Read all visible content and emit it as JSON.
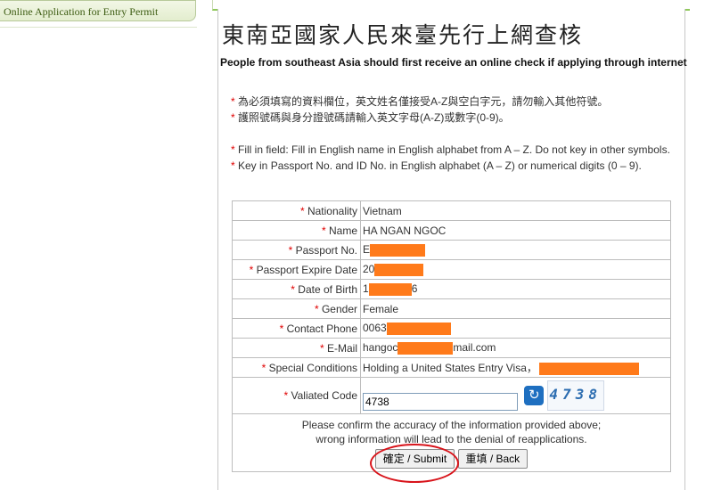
{
  "sidebar": {
    "link_label": "Online Application for Entry Permit"
  },
  "header": {
    "title_zh": "東南亞國家人民來臺先行上網查核",
    "title_en": "People from southeast Asia should first receive an online check if applying through internet"
  },
  "notes": {
    "star": "*",
    "zh_1": " 為必須填寫的資料欄位，英文姓名僅接受A-Z與空白字元，請勿輸入其他符號。",
    "zh_2": " 護照號碼與身分證號碼請輸入英文字母(A-Z)或數字(0-9)。",
    "en_1": " Fill in field: Fill in English name in English alphabet from A – Z. Do not key in other symbols.",
    "en_2": " Key in Passport No. and ID No. in English alphabet (A – Z) or numerical digits (0 – 9)."
  },
  "form": {
    "star": "*",
    "nationality_label": " Nationality",
    "nationality_value": "Vietnam",
    "name_label": " Name",
    "name_value": "HA NGAN NGOC",
    "passport_label": " Passport No.",
    "passport_prefix": "E",
    "expire_label": " Passport Expire Date",
    "expire_prefix": "20",
    "dob_label": " Date of Birth",
    "dob_prefix": "1",
    "dob_suffix": "6",
    "gender_label": " Gender",
    "gender_value": "Female",
    "phone_label": " Contact Phone",
    "phone_prefix": "0063",
    "email_label": " E-Mail",
    "email_prefix": "hangoc",
    "email_suffix": "mail.com",
    "special_label": " Special Conditions",
    "special_value": "Holding a United States Entry Visa，",
    "code_label": " Valiated Code",
    "code_value": "4738",
    "captcha_text": "4738"
  },
  "confirm": {
    "line_1": "Please confirm the accuracy of the information provided above;",
    "line_2": "wrong information will lead to the denial of reapplications.",
    "submit_label": "確定 / Submit",
    "back_label": "重填 / Back"
  },
  "colors": {
    "required_star": "#e00000",
    "redaction": "#ff7a1a",
    "highlight": "#d8141b"
  },
  "icons": {
    "refresh": "refresh-icon"
  }
}
